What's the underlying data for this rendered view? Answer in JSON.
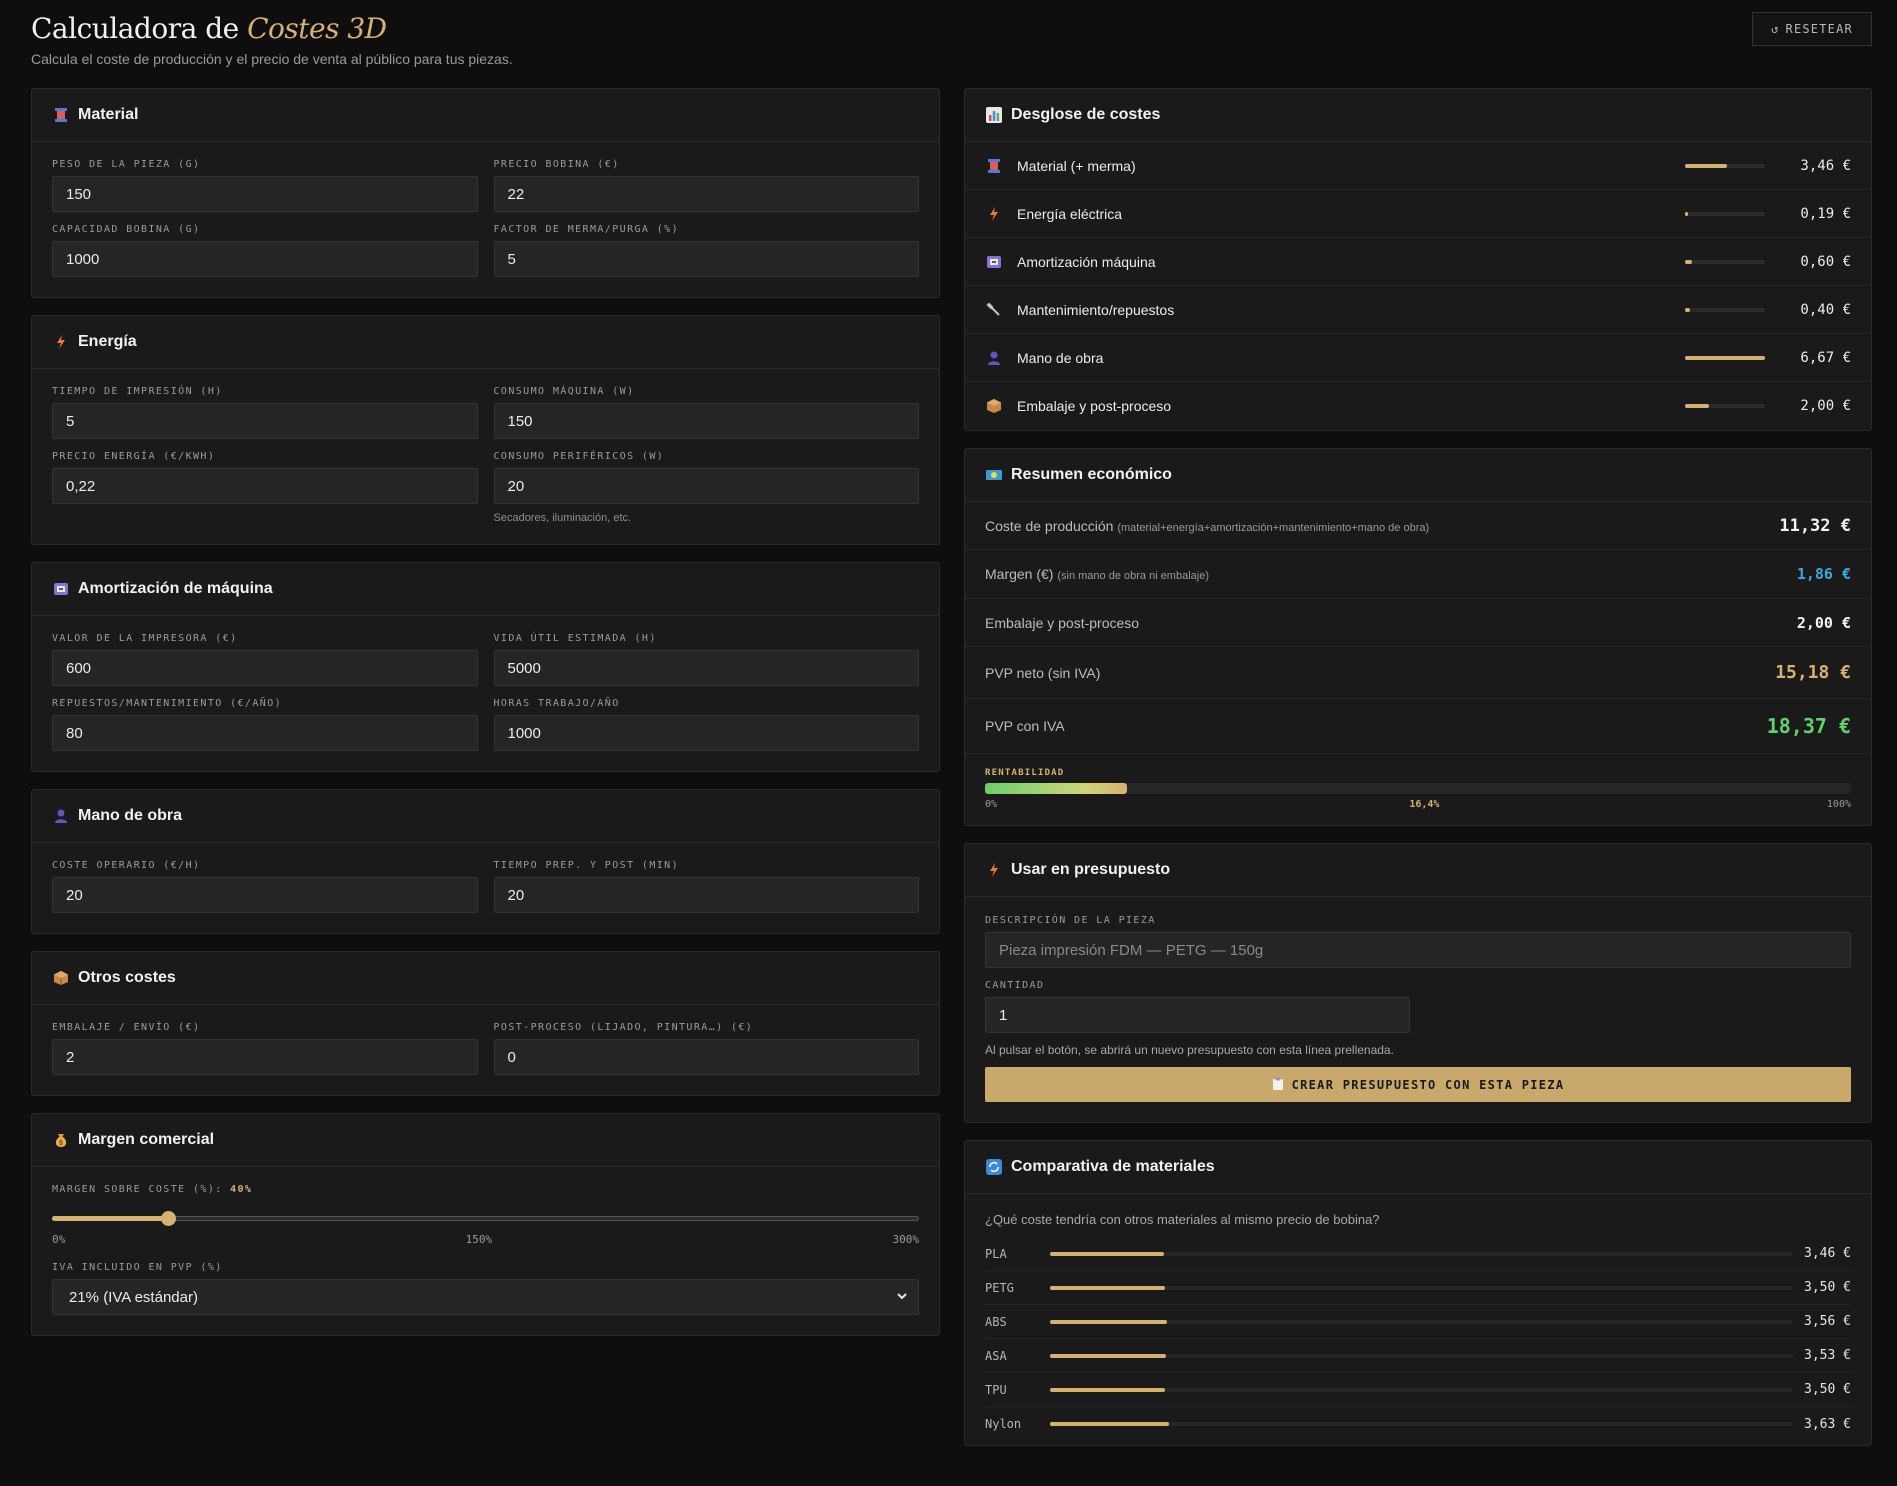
{
  "header": {
    "title_prefix": "Calculadora de",
    "title_accent": "Costes 3D",
    "subtitle": "Calcula el coste de producción y el precio de venta al público para tus piezas.",
    "reset_label": "RESETEAR",
    "reset_icon": "↺"
  },
  "colors": {
    "background": "#0e0e0e",
    "accent": "#d6b16f",
    "green": "#5fd36a",
    "blue": "#3aa9e0"
  },
  "material": {
    "title": "Material",
    "icon": "spool-icon",
    "fields": [
      {
        "label": "PESO DE LA PIEZA (G)",
        "value": "150"
      },
      {
        "label": "PRECIO BOBINA (€)",
        "value": "22"
      },
      {
        "label": "CAPACIDAD BOBINA (G)",
        "value": "1000"
      },
      {
        "label": "FACTOR DE MERMA/PURGA (%)",
        "value": "5"
      }
    ]
  },
  "energia": {
    "title": "Energía",
    "icon": "lightning-icon",
    "fields": [
      {
        "label": "TIEMPO DE IMPRESIÓN (H)",
        "value": "5"
      },
      {
        "label": "CONSUMO MÁQUINA (W)",
        "value": "150"
      },
      {
        "label": "PRECIO ENERGÍA (€/KWH)",
        "value": "0,22"
      },
      {
        "label": "CONSUMO PERIFÉRICOS (W)",
        "value": "20"
      }
    ],
    "hint": "Secadores, iluminación, etc."
  },
  "amortizacion": {
    "title": "Amortización de máquina",
    "icon": "printer-icon",
    "fields": [
      {
        "label": "VALOR DE LA IMPRESORA (€)",
        "value": "600"
      },
      {
        "label": "VIDA ÚTIL ESTIMADA (H)",
        "value": "5000"
      },
      {
        "label": "REPUESTOS/MANTENIMIENTO (€/AÑO)",
        "value": "80"
      },
      {
        "label": "HORAS TRABAJO/AÑO",
        "value": "1000"
      }
    ]
  },
  "mano_obra": {
    "title": "Mano de obra",
    "icon": "person-icon",
    "fields": [
      {
        "label": "COSTE OPERARIO (€/H)",
        "value": "20"
      },
      {
        "label": "TIEMPO PREP. Y POST (MIN)",
        "value": "20"
      }
    ]
  },
  "otros": {
    "title": "Otros costes",
    "icon": "package-icon",
    "fields": [
      {
        "label": "EMBALAJE / ENVÍO (€)",
        "value": "2"
      },
      {
        "label": "POST-PROCESO (LIJADO, PINTURA…) (€)",
        "value": "0"
      }
    ]
  },
  "margen": {
    "title": "Margen comercial",
    "icon": "money-bag-icon",
    "slider_label": "MARGEN SOBRE COSTE (%):",
    "slider_value_label": "40%",
    "slider_value": 40,
    "slider_max": 300,
    "scale": [
      "0%",
      "150%",
      "300%"
    ],
    "iva_label": "IVA INCLUIDO EN PVP (%)",
    "iva_selected": "21% (IVA estándar)"
  },
  "desglose": {
    "title": "Desglose de costes",
    "icon": "bar-chart-icon",
    "rows": [
      {
        "label": "Material (+ merma)",
        "value": "3,46 €",
        "share": 0.52,
        "icon": "spool-icon"
      },
      {
        "label": "Energía eléctrica",
        "value": "0,19 €",
        "share": 0.03,
        "icon": "lightning-icon"
      },
      {
        "label": "Amortización máquina",
        "value": "0,60 €",
        "share": 0.09,
        "icon": "printer-icon"
      },
      {
        "label": "Mantenimiento/repuestos",
        "value": "0,40 €",
        "share": 0.06,
        "icon": "wrench-icon"
      },
      {
        "label": "Mano de obra",
        "value": "6,67 €",
        "share": 1.0,
        "icon": "person-icon"
      },
      {
        "label": "Embalaje y post-proceso",
        "value": "2,00 €",
        "share": 0.3,
        "icon": "package-icon"
      }
    ]
  },
  "resumen": {
    "title": "Resumen económico",
    "icon": "money-icon",
    "rows": [
      {
        "label": "Coste de producción",
        "note": "(material+energía+amortización+mantenimiento+mano de obra)",
        "value": "11,32 €"
      },
      {
        "label": "Margen (€)",
        "note": "(sin mano de obra ni embalaje)",
        "value": "1,86 €"
      },
      {
        "label": "Embalaje y post-proceso",
        "note": "",
        "value": "2,00 €"
      },
      {
        "label": "PVP neto (sin IVA)",
        "note": "",
        "value": "15,18 €"
      },
      {
        "label": "PVP con IVA",
        "note": "",
        "value": "18,37 €"
      }
    ],
    "rent_label": "RENTABILIDAD",
    "rent_value_label": "16,4%",
    "rent_fraction": 0.164,
    "rent_scale_min": "0%",
    "rent_scale_max": "100%"
  },
  "presupuesto": {
    "title": "Usar en presupuesto",
    "icon": "lightning-icon",
    "desc_label": "DESCRIPCIÓN DE LA PIEZA",
    "desc_placeholder": "Pieza impresión FDM — PETG — 150g",
    "qty_label": "CANTIDAD",
    "qty_value": "1",
    "hint": "Al pulsar el botón, se abrirá un nuevo presupuesto con esta línea prellenada.",
    "button_label": "CREAR PRESUPUESTO CON ESTA PIEZA",
    "button_icon": "clipboard-icon"
  },
  "comparativa": {
    "title": "Comparativa de materiales",
    "icon": "refresh-icon",
    "question": "¿Qué coste tendría con otros materiales al mismo precio de bobina?",
    "rows": [
      {
        "name": "PLA",
        "value": "3,46 €",
        "cost": 3.46
      },
      {
        "name": "PETG",
        "value": "3,50 €",
        "cost": 3.5
      },
      {
        "name": "ABS",
        "value": "3,56 €",
        "cost": 3.56
      },
      {
        "name": "ASA",
        "value": "3,53 €",
        "cost": 3.53
      },
      {
        "name": "TPU",
        "value": "3,50 €",
        "cost": 3.5
      },
      {
        "name": "Nylon",
        "value": "3,63 €",
        "cost": 3.63
      }
    ]
  }
}
